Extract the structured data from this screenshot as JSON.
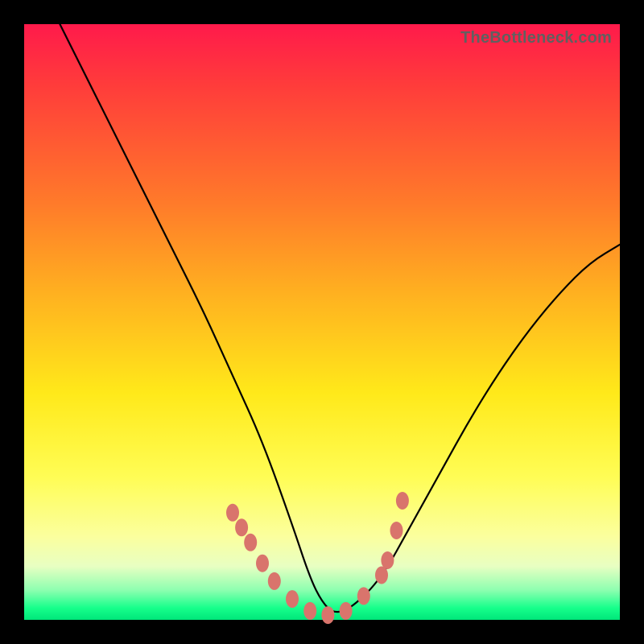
{
  "watermark": "TheBottleneck.com",
  "chart_data": {
    "type": "line",
    "title": "",
    "xlabel": "",
    "ylabel": "",
    "xlim": [
      0,
      100
    ],
    "ylim": [
      0,
      100
    ],
    "grid": false,
    "series": [
      {
        "name": "curve",
        "x": [
          6,
          10,
          15,
          20,
          25,
          30,
          35,
          40,
          45,
          48,
          50,
          52,
          55,
          60,
          65,
          70,
          75,
          80,
          85,
          90,
          95,
          100
        ],
        "y": [
          100,
          92,
          82,
          72,
          62,
          52,
          41,
          30,
          16,
          7,
          3,
          1,
          2,
          7,
          16,
          25,
          34,
          42,
          49,
          55,
          60,
          63
        ]
      }
    ],
    "markers": {
      "name": "highlight-points",
      "x": [
        35,
        36.5,
        38,
        40,
        42,
        45,
        48,
        51,
        54,
        57,
        60,
        61,
        62.5,
        63.5
      ],
      "y": [
        18,
        15.5,
        13,
        9.5,
        6.5,
        3.5,
        1.5,
        0.8,
        1.5,
        4,
        7.5,
        10,
        15,
        20
      ]
    }
  }
}
